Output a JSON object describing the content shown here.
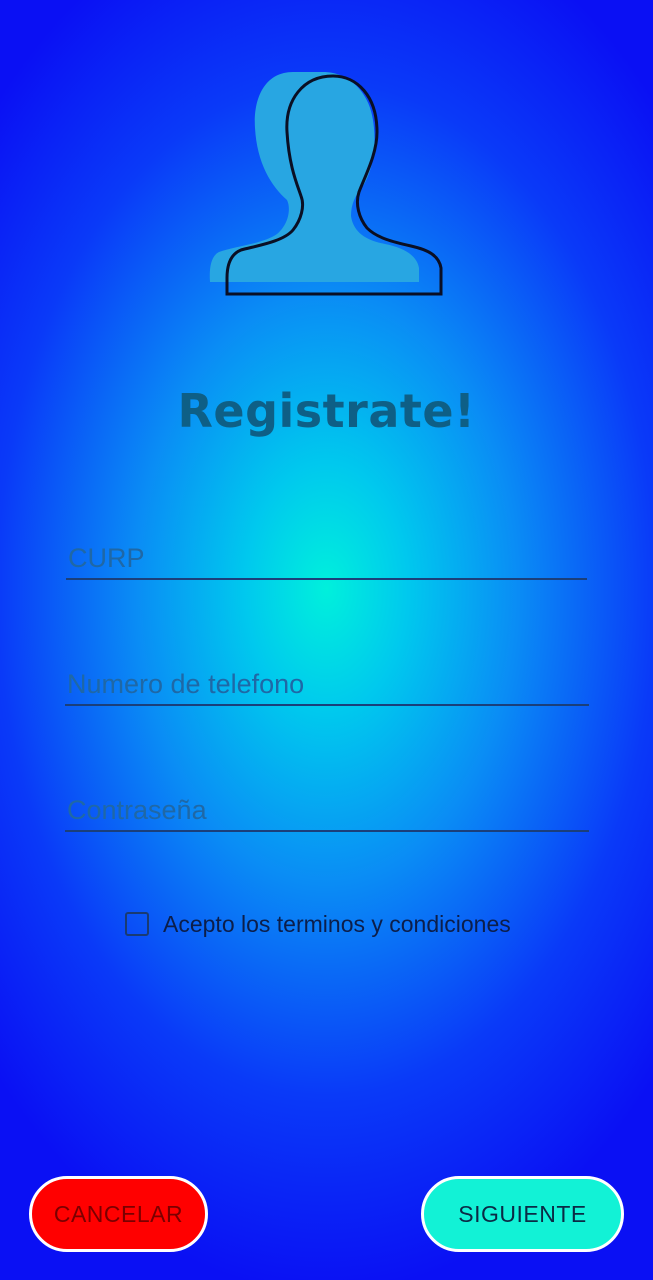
{
  "header": {
    "avatar_icon": "user-silhouette-icon",
    "title": "Registrate!"
  },
  "form": {
    "curp": {
      "placeholder": "CURP",
      "value": ""
    },
    "phone": {
      "placeholder": "Numero de telefono",
      "value": ""
    },
    "password": {
      "placeholder": "Contraseña",
      "value": ""
    }
  },
  "terms": {
    "label": "Acepto los terminos y condiciones",
    "checked": false
  },
  "buttons": {
    "cancel_label": "CANCELAR",
    "next_label": "SIGUIENTE"
  },
  "colors": {
    "title": "#0e5f86",
    "cancel_bg": "#ff0000",
    "next_bg": "#12f2d6",
    "gradient_center": "#00f0dc",
    "gradient_edge": "#0a10f4"
  }
}
